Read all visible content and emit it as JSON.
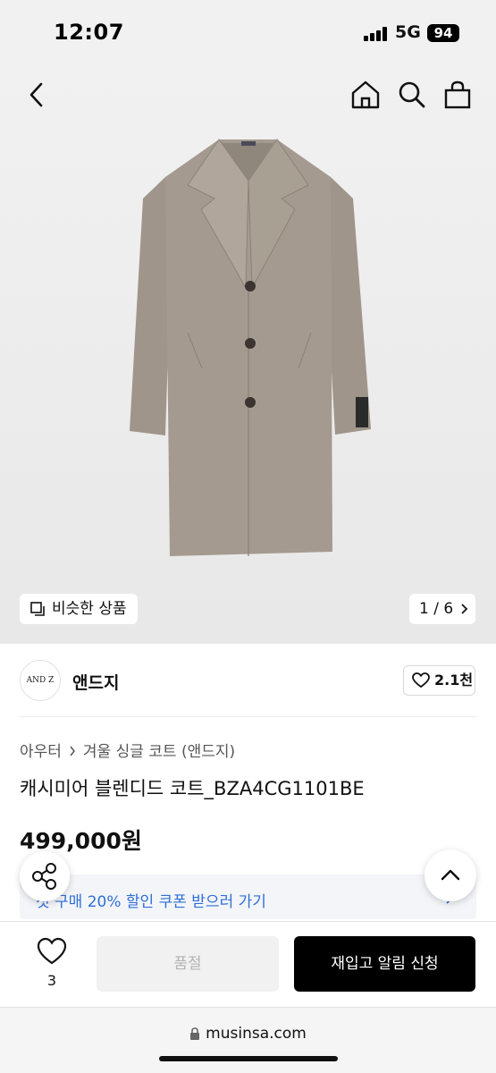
{
  "status_bar": {
    "time": "12:07",
    "network": "5G",
    "battery": "94"
  },
  "nav": {
    "back_icon": "chevron-left-icon",
    "home_icon": "home-icon",
    "search_icon": "search-icon",
    "cart_icon": "shopping-bag-icon"
  },
  "gallery": {
    "similar_label": "비슷한 상품",
    "counter": "1 / 6"
  },
  "brand": {
    "logo_text": "AND Z",
    "name": "앤드지",
    "likes": "2.1천"
  },
  "product": {
    "breadcrumb": [
      "아우터",
      "겨울 싱글 코트 (앤드지)"
    ],
    "title": "캐시미어 블렌디드 코트_BZA4CG1101BE",
    "price": "499,000원"
  },
  "coupon": {
    "text": "첫 구매 20% 할인 쿠폰 받으러 가기"
  },
  "actions": {
    "wish_count": "3",
    "soldout_label": "품절",
    "restock_label": "재입고 알림 신청"
  },
  "browser": {
    "url": "musinsa.com"
  },
  "colors": {
    "accent_blue": "#2f6fd6",
    "primary_button": "#000000",
    "coat": "#a49a8f"
  }
}
